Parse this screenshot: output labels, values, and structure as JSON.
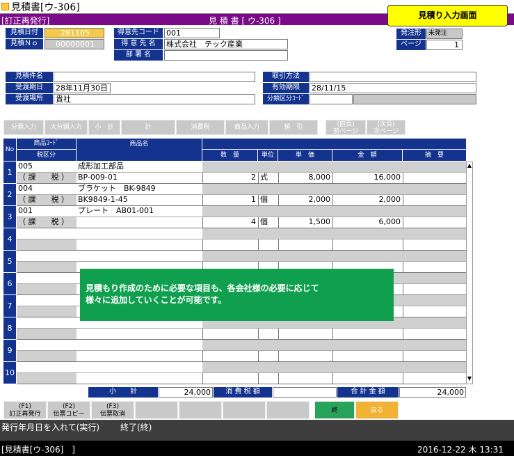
{
  "window": {
    "title": "見積書[ウ-306]"
  },
  "banner": {
    "mode": "[訂正再発行]",
    "center": "見 積 書 [ ウ-306 ]"
  },
  "badge": "見積り入力画面",
  "header": {
    "date_label": "見積日付",
    "date_value": "281105",
    "no_label": "見積Ｎｏ",
    "no_value": "00000001",
    "cust_code_label": "得意先コード",
    "cust_code_value": "001",
    "cust_name_label": "得 意 先 名",
    "cust_name_value": "株式会社　テック産業",
    "dept_label": "部 署 名",
    "dept_value": "",
    "type_label": "発注形",
    "type_value": "未発注",
    "page_label": "ページ",
    "page_value": "1"
  },
  "info": {
    "subject_label": "見積件名",
    "subject_value": "",
    "delivery_label": "受渡期日",
    "delivery_value": "28年11月30日",
    "place_label": "受渡場所",
    "place_value": "貴社",
    "method_label": "取引方法",
    "method_value": "",
    "expiry_label": "有効期限",
    "expiry_value": "28/11/15",
    "cat_label": "分類区分ｺｰﾄﾞ",
    "cat_value": ""
  },
  "toolbar": [
    "分類入力",
    "大分類入力",
    "小　計",
    "計",
    "消費税",
    "商品入力",
    "値　引",
    "(前頁)\n前ページ",
    "(次頁)\n次ページ"
  ],
  "columns": {
    "no": "No",
    "code": "商品ｺｰﾄﾞ",
    "tax": "税区分",
    "name": "商品名",
    "qty": "数　量",
    "unit": "単位",
    "price": "単　価",
    "amount": "金　額",
    "memo": "摘　要"
  },
  "rows": [
    {
      "no": "1",
      "code": "005",
      "tax": "（ 課　　税 ）",
      "name1": "成形加工部品",
      "name2": "BP-009-01",
      "qty": "2",
      "unit": "式",
      "price": "8,000",
      "amount": "16,000"
    },
    {
      "no": "2",
      "code": "004",
      "tax": "（ 課　　税 ）",
      "name1": "ブラケット　BK-9849",
      "name2": "BK9849-1-45",
      "qty": "1",
      "unit": "個",
      "price": "2,000",
      "amount": "2,000"
    },
    {
      "no": "3",
      "code": "001",
      "tax": "（ 課　　税 ）",
      "name1": "プレート　AB01-001",
      "name2": "",
      "qty": "4",
      "unit": "個",
      "price": "1,500",
      "amount": "6,000"
    },
    {
      "no": "4"
    },
    {
      "no": "5"
    },
    {
      "no": "6"
    },
    {
      "no": "7"
    },
    {
      "no": "8"
    },
    {
      "no": "9"
    },
    {
      "no": "10"
    }
  ],
  "totals": {
    "subtotal_label": "小　　計",
    "subtotal_value": "24,000",
    "tax_label": "消 費 税 額",
    "tax_value": "",
    "total_label": "合 計 金 額",
    "total_value": "24,000"
  },
  "callout": {
    "line1": "見積もり作成のために必要な項目も、各会社様の必要に応じて",
    "line2": "様々に追加していくことが可能です。"
  },
  "fkeys": [
    {
      "k": "(F1)",
      "l": "訂正再発行"
    },
    {
      "k": "(F2)",
      "l": "伝票コピー"
    },
    {
      "k": "(F3)",
      "l": "伝票取消"
    }
  ],
  "end_button": "終",
  "back_button": "戻る",
  "command": {
    "prompt": "発行年月日を入れて(実行)",
    "exit": "終了(終)"
  },
  "status": {
    "left": "[見積書[ウ-306]　]",
    "right": "2016-12-22 木 13:31"
  },
  "colors": {
    "navy": "#13338f",
    "purple": "#7a0a87",
    "green": "#0f9f4f",
    "yellow": "#ffff00"
  }
}
